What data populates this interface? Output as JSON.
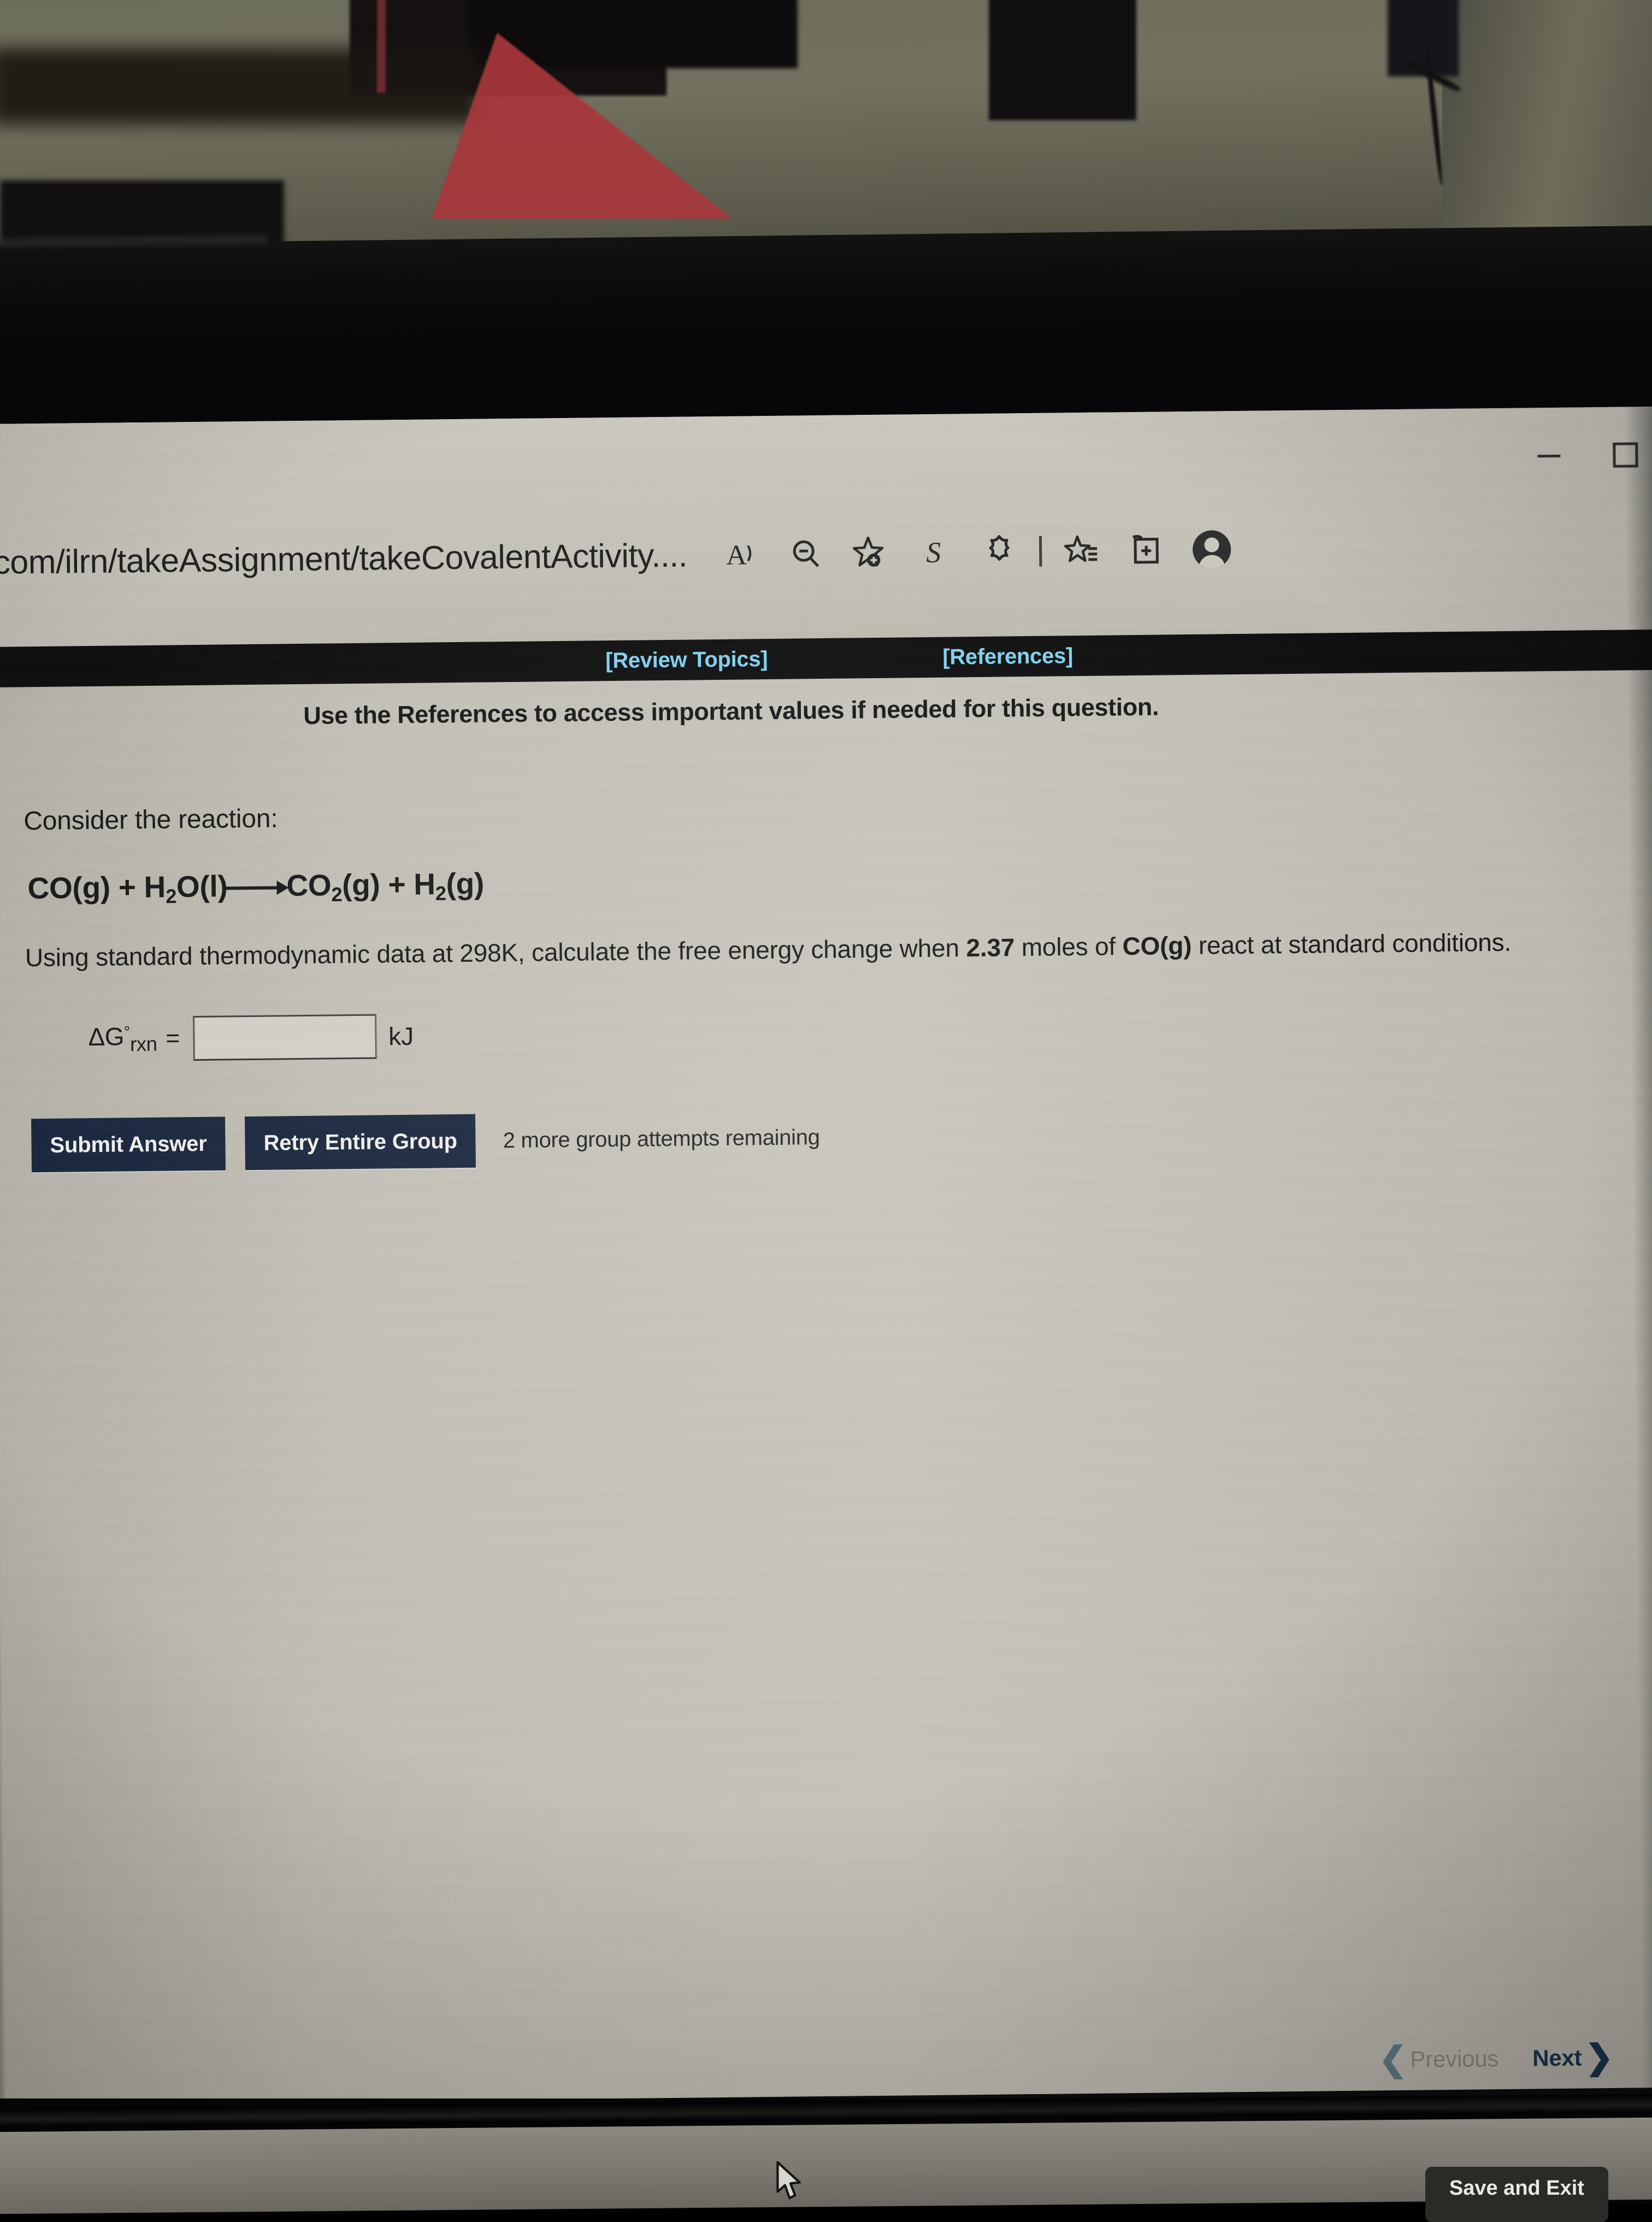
{
  "browser": {
    "url": "v.com/ilrn/takeAssignment/takeCovalentActivity....",
    "window_controls": {
      "minimize_label": "Minimize",
      "maximize_label": "Maximize"
    },
    "toolbar_icons": [
      {
        "name": "read-aloud-icon",
        "glyph": "A"
      },
      {
        "name": "search-page-icon",
        "glyph": "Q"
      },
      {
        "name": "add-favorite-icon",
        "glyph": "star-plus"
      },
      {
        "name": "split-screen-icon",
        "glyph": "S"
      },
      {
        "name": "copilot-icon",
        "glyph": "copilot"
      },
      {
        "name": "favorites-list-icon",
        "glyph": "star-list"
      },
      {
        "name": "collections-icon",
        "glyph": "box-plus"
      },
      {
        "name": "profile-avatar",
        "glyph": "person"
      }
    ]
  },
  "nav_bar": {
    "review_topics": "[Review Topics]",
    "references": "[References]"
  },
  "content": {
    "instruction": "Use the References to access important values if needed for this question.",
    "consider_line": "Consider the reaction:",
    "equation": {
      "reactant_1": "CO(g)",
      "plus_1": "+",
      "reactant_2_pre": "H",
      "reactant_2_sub": "2",
      "reactant_2_post": "O(l)",
      "product_1_pre": "CO",
      "product_1_sub": "2",
      "product_1_post": "(g)",
      "plus_2": "+",
      "product_2_pre": "H",
      "product_2_sub": "2",
      "product_2_post": "(g)",
      "full_text": "CO(g) + H2O(l) ⟶ CO2(g) + H2(g)"
    },
    "question": {
      "part_1": "Using standard thermodynamic data at 298K, calculate the free energy change when ",
      "moles_value": "2.37",
      "part_2": " moles of ",
      "species_bold": "CO(g)",
      "part_3": " react at standard conditions.",
      "temperature": "298K"
    },
    "answer": {
      "label_delta": "Δ",
      "label_g": "G",
      "label_degree": "°",
      "label_sub": "rxn",
      "equals": "=",
      "value": "",
      "placeholder": "",
      "unit": "kJ"
    },
    "buttons": {
      "submit": "Submit Answer",
      "retry": "Retry Entire Group"
    },
    "attempts_text": "2 more group attempts remaining"
  },
  "footer": {
    "previous": "Previous",
    "next": "Next",
    "save_and_exit": "Save and Exit"
  },
  "colors": {
    "link_blue": "#7fd3f2",
    "button_navy": "#122038",
    "nav_bar_black": "#090909",
    "page_background": "#c5c2b8",
    "next_dark_blue": "#15314d",
    "previous_grey": "#8c8a82"
  }
}
